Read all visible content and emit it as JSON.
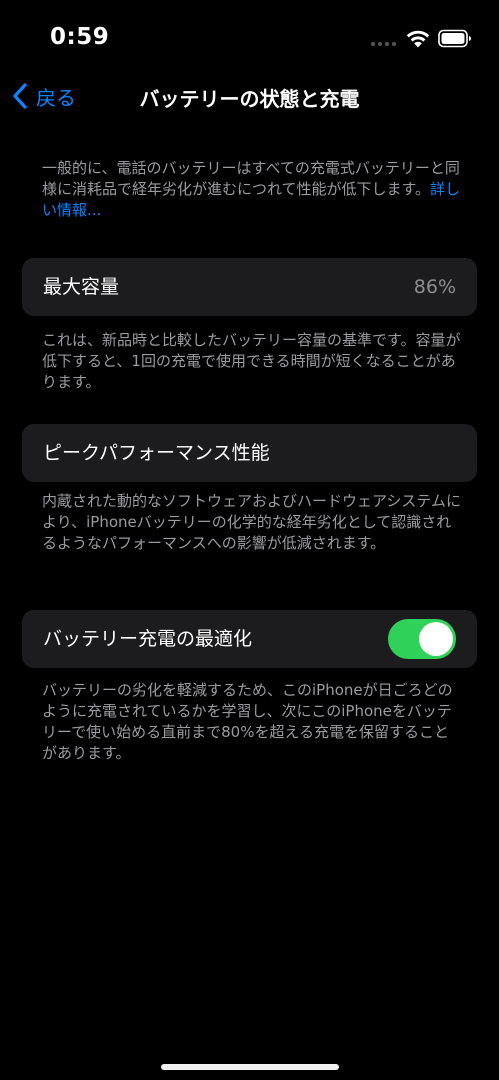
{
  "status_bar": {
    "time": "0:59"
  },
  "nav": {
    "back_label": "戻る",
    "title": "バッテリーの状態と充電"
  },
  "intro": {
    "text": "一般的に、電話のバッテリーはすべての充電式バッテリーと同様に消耗品で経年劣化が進むにつれて性能が低下します。",
    "link": "詳しい情報..."
  },
  "max_capacity": {
    "label": "最大容量",
    "value": "86%",
    "footnote": "これは、新品時と比較したバッテリー容量の基準です。容量が低下すると、1回の充電で使用できる時間が短くなることがあります。"
  },
  "peak_performance": {
    "label": "ピークパフォーマンス性能",
    "footnote": "内蔵された動的なソフトウェアおよびハードウェアシステムにより、iPhoneバッテリーの化学的な経年劣化として認識されるようなパフォーマンスへの影響が低減されます。"
  },
  "optimized_charging": {
    "label": "バッテリー充電の最適化",
    "enabled": true,
    "footnote": "バッテリーの劣化を軽減するため、このiPhoneが日ごろどのように充電されているかを学習し、次にこのiPhoneをバッテリーで使い始める直前まで80%を超える充電を保留することがあります。"
  },
  "colors": {
    "background": "#000000",
    "card": "#1c1c1e",
    "accent": "#0a84ff",
    "toggle_on": "#30d158",
    "secondary_text": "#9a9aa0"
  }
}
